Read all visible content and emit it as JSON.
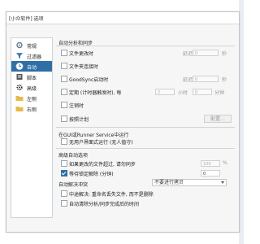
{
  "window": {
    "title": "[小众软件] 选项"
  },
  "sidebar": {
    "items": [
      {
        "label": "常规",
        "icon": "gear-icon"
      },
      {
        "label": "过滤器",
        "icon": "filter-icon"
      },
      {
        "label": "自动",
        "icon": "clock-icon"
      },
      {
        "label": "脚本",
        "icon": "script-icon"
      },
      {
        "label": "高级",
        "icon": "gear-advanced-icon"
      },
      {
        "label": "左侧",
        "icon": "folder-left-icon"
      },
      {
        "label": "右侧",
        "icon": "folder-right-icon"
      }
    ]
  },
  "auto": {
    "section_title": "自动分析和同步",
    "file_change": {
      "label": "文件更改时",
      "delay_label": "延迟",
      "delay_value": "0",
      "unit": "秒"
    },
    "folder_connect": {
      "label": "文件夹连接时"
    },
    "goodsync": {
      "label": "GoodSync启动时",
      "delay_label": "延迟",
      "delay_value": "0",
      "unit": "秒"
    },
    "timer": {
      "label": "定期 (计时器触发时), 每",
      "hours_value": "2",
      "hours_unit": "小时",
      "minutes_value": "0",
      "minutes_unit": "分钟"
    },
    "logoff": {
      "label": "注销时"
    },
    "schedule": {
      "label": "按照计划",
      "button": "配置..."
    },
    "runner_title": "在GUI或Runner Service中运行",
    "no_user": {
      "label": "无用户界面式运行 (无人值守)"
    },
    "options_title": "高级自动选项",
    "changed_over": {
      "label": "如果更改的文件超过, 请勿同步",
      "value": "100",
      "unit": "%"
    },
    "wait_lock": {
      "label": "等待锁定解除 (分钟)",
      "value": "0"
    },
    "conflict_label": "自动解决冲突",
    "conflict_select": "不要进行拷贝",
    "interrupt": {
      "label": "中途解决: 重命名丢失文件, 而不是删除"
    },
    "auto_clear": {
      "label": "自动清除分析/同步完成后的时间"
    }
  },
  "colors": {
    "accent": "#2f6fa6"
  }
}
